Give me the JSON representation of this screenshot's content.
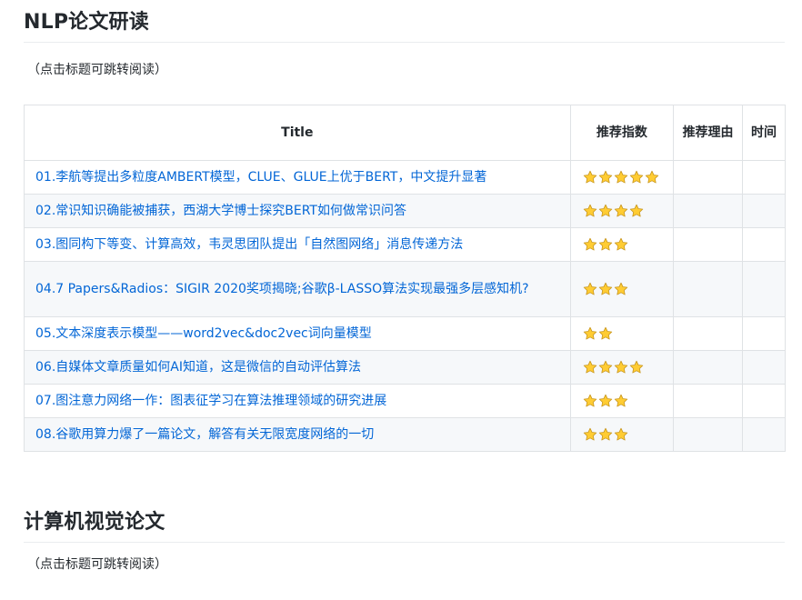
{
  "sections": [
    {
      "heading": "NLP论文研读",
      "hint": "（点击标题可跳转阅读）"
    },
    {
      "heading": "计算机视觉论文",
      "hint": "（点击标题可跳转阅读）"
    }
  ],
  "table": {
    "headers": {
      "title": "Title",
      "rating": "推荐指数",
      "reason": "推荐理由",
      "time": "时间"
    },
    "rows": [
      {
        "title": "01.李航等提出多粒度AMBERT模型，CLUE、GLUE上优于BERT，中文提升显著",
        "stars": 5
      },
      {
        "title": "02.常识知识确能被捕获，西湖大学博士探究BERT如何做常识问答",
        "stars": 4
      },
      {
        "title": "03.图同构下等变、计算高效，韦灵思团队提出「自然图网络」消息传递方法",
        "stars": 3
      },
      {
        "title": "04.7 Papers&Radios：SIGIR 2020奖项揭晓;谷歌β-LASSO算法实现最强多层感知机?",
        "stars": 3
      },
      {
        "title": "05.文本深度表示模型——word2vec&doc2vec词向量模型",
        "stars": 2
      },
      {
        "title": "06.自媒体文章质量如何AI知道，这是微信的自动评估算法",
        "stars": 4
      },
      {
        "title": "07.图注意力网络一作：图表征学习在算法推理领域的研究进展",
        "stars": 3
      },
      {
        "title": "08.谷歌用算力爆了一篇论文，解答有关无限宽度网络的一切",
        "stars": 3
      }
    ]
  },
  "colors": {
    "link": "#0366d6",
    "star": "#ffcc33",
    "star_outline": "#c8961e"
  },
  "icons": {
    "rating": "star-icon"
  }
}
